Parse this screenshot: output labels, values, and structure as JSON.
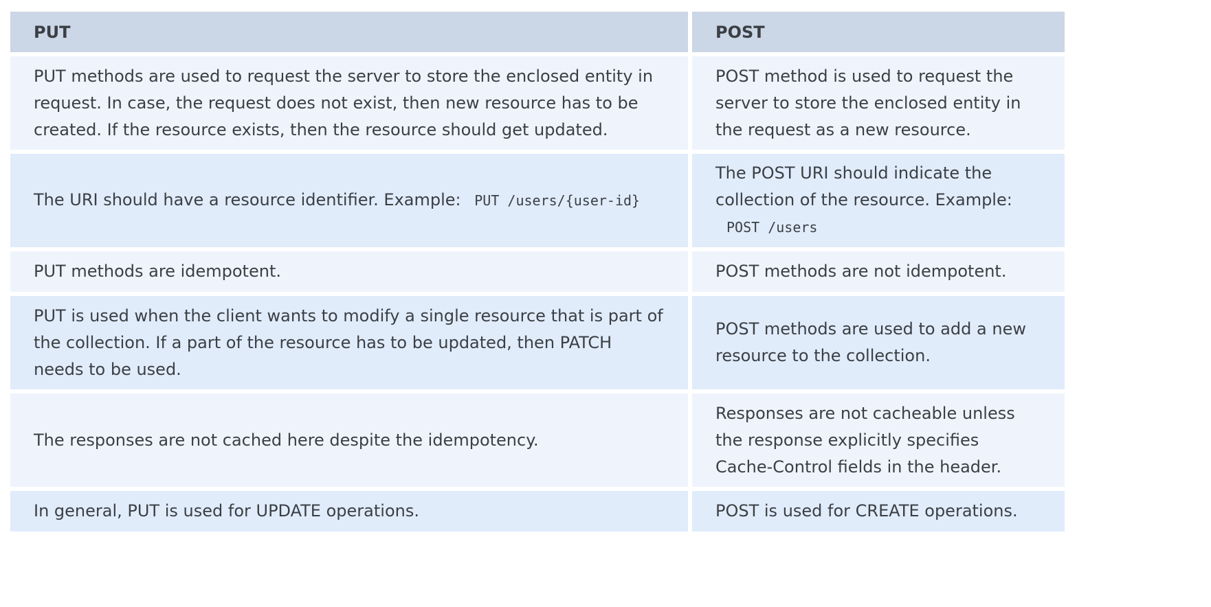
{
  "headers": [
    "PUT",
    "POST"
  ],
  "rows": [
    {
      "put": "PUT methods are used to request the server to store the enclosed entity in request. In case, the request does not exist, then new resource has to be created. If the resource exists, then the resource should get updated.",
      "post": "POST method is used to request the server to store the enclosed entity in the request as a new resource."
    },
    {
      "put_text": "The URI should have a resource identifier. Example:",
      "put_code": "PUT /users/{user-id}",
      "post_text": "The POST URI should indicate the collection of the resource. Example:",
      "post_code": "POST /users"
    },
    {
      "put": "PUT methods are idempotent.",
      "post": "POST methods are not idempotent."
    },
    {
      "put": "PUT is used when the client wants to modify a single resource that is part of the collection. If a part of the resource has to be updated, then PATCH needs to be used.",
      "post": "POST methods are used to add a new resource to the collection."
    },
    {
      "put": "The responses are not cached here despite the idempotency.",
      "post": "Responses are not cacheable unless the response explicitly specifies Cache-Control fields in the header."
    },
    {
      "put": "In general, PUT is used for UPDATE operations.",
      "post": "POST is used for CREATE operations."
    }
  ]
}
